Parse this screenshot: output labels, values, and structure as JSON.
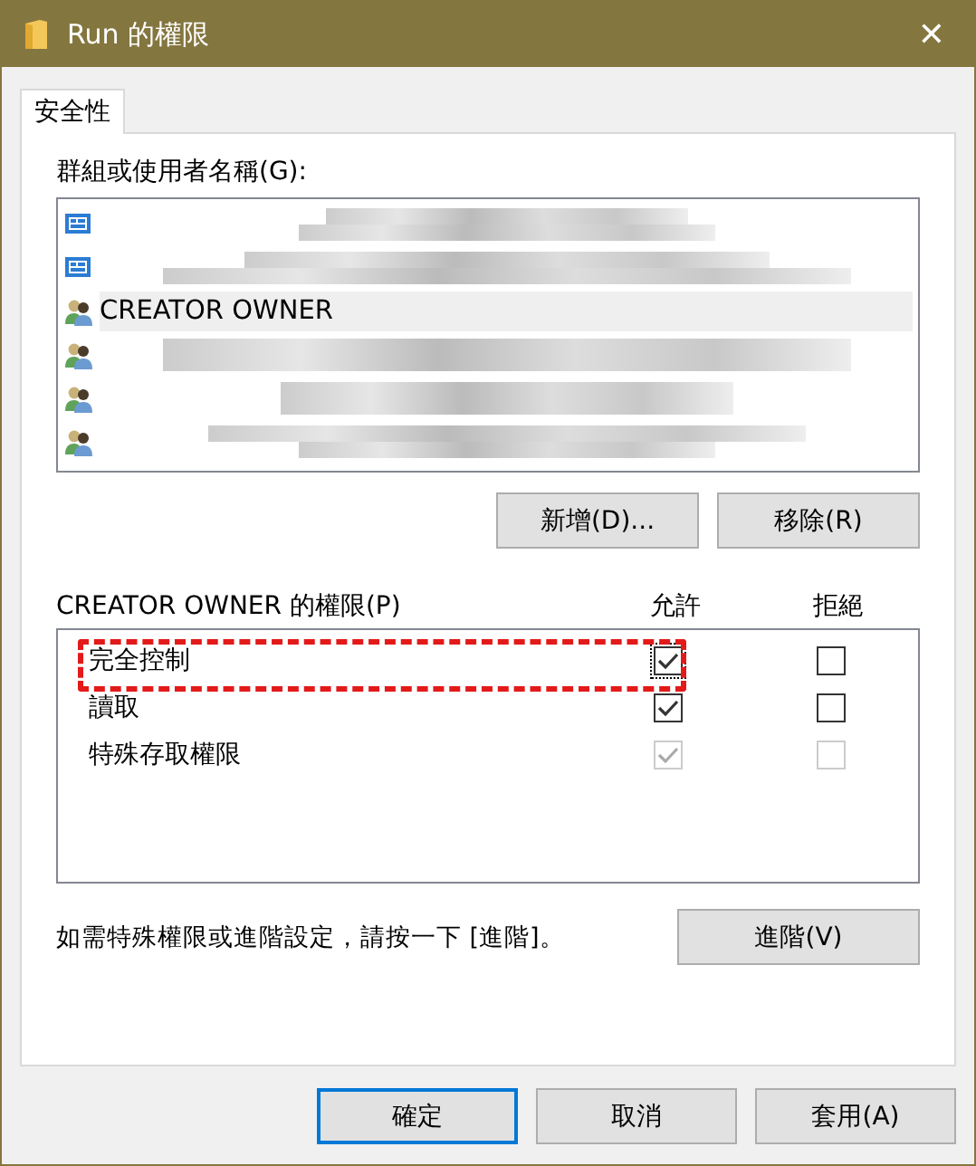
{
  "window": {
    "title": "Run 的權限",
    "close": "✕"
  },
  "tabs": [
    {
      "label": "安全性",
      "selected": true
    }
  ],
  "principals_label": "群組或使用者名稱(G):",
  "principals": [
    {
      "kind": "computer",
      "redacted": true,
      "selected": false
    },
    {
      "kind": "computer",
      "redacted": true,
      "selected": false
    },
    {
      "kind": "group",
      "name": "CREATOR OWNER",
      "redacted": false,
      "selected": true
    },
    {
      "kind": "group",
      "redacted": true,
      "selected": false
    },
    {
      "kind": "group",
      "redacted": true,
      "selected": false
    },
    {
      "kind": "group",
      "redacted": true,
      "selected": false
    }
  ],
  "principal_buttons": [
    {
      "label": "新增(D)..."
    },
    {
      "label": "移除(R)"
    }
  ],
  "permissions_label": "CREATOR OWNER 的權限(P)",
  "permission_columns": [
    "允許",
    "拒絕"
  ],
  "permissions": [
    {
      "name": "完全控制",
      "highlighted": true,
      "allow": {
        "checked": true,
        "disabled": false,
        "focused": true
      },
      "deny": {
        "checked": false,
        "disabled": false,
        "focused": false
      }
    },
    {
      "name": "讀取",
      "highlighted": false,
      "allow": {
        "checked": true,
        "disabled": false,
        "focused": false
      },
      "deny": {
        "checked": false,
        "disabled": false,
        "focused": false
      }
    },
    {
      "name": "特殊存取權限",
      "highlighted": false,
      "allow": {
        "checked": true,
        "disabled": true,
        "focused": false
      },
      "deny": {
        "checked": false,
        "disabled": true,
        "focused": false
      }
    }
  ],
  "advanced_hint": "如需特殊權限或進階設定，請按一下 [進階]。",
  "advanced_button": "進階(V)",
  "dialog_buttons": [
    {
      "label": "確定",
      "default": true
    },
    {
      "label": "取消",
      "default": false
    },
    {
      "label": "套用(A)",
      "default": false
    }
  ]
}
